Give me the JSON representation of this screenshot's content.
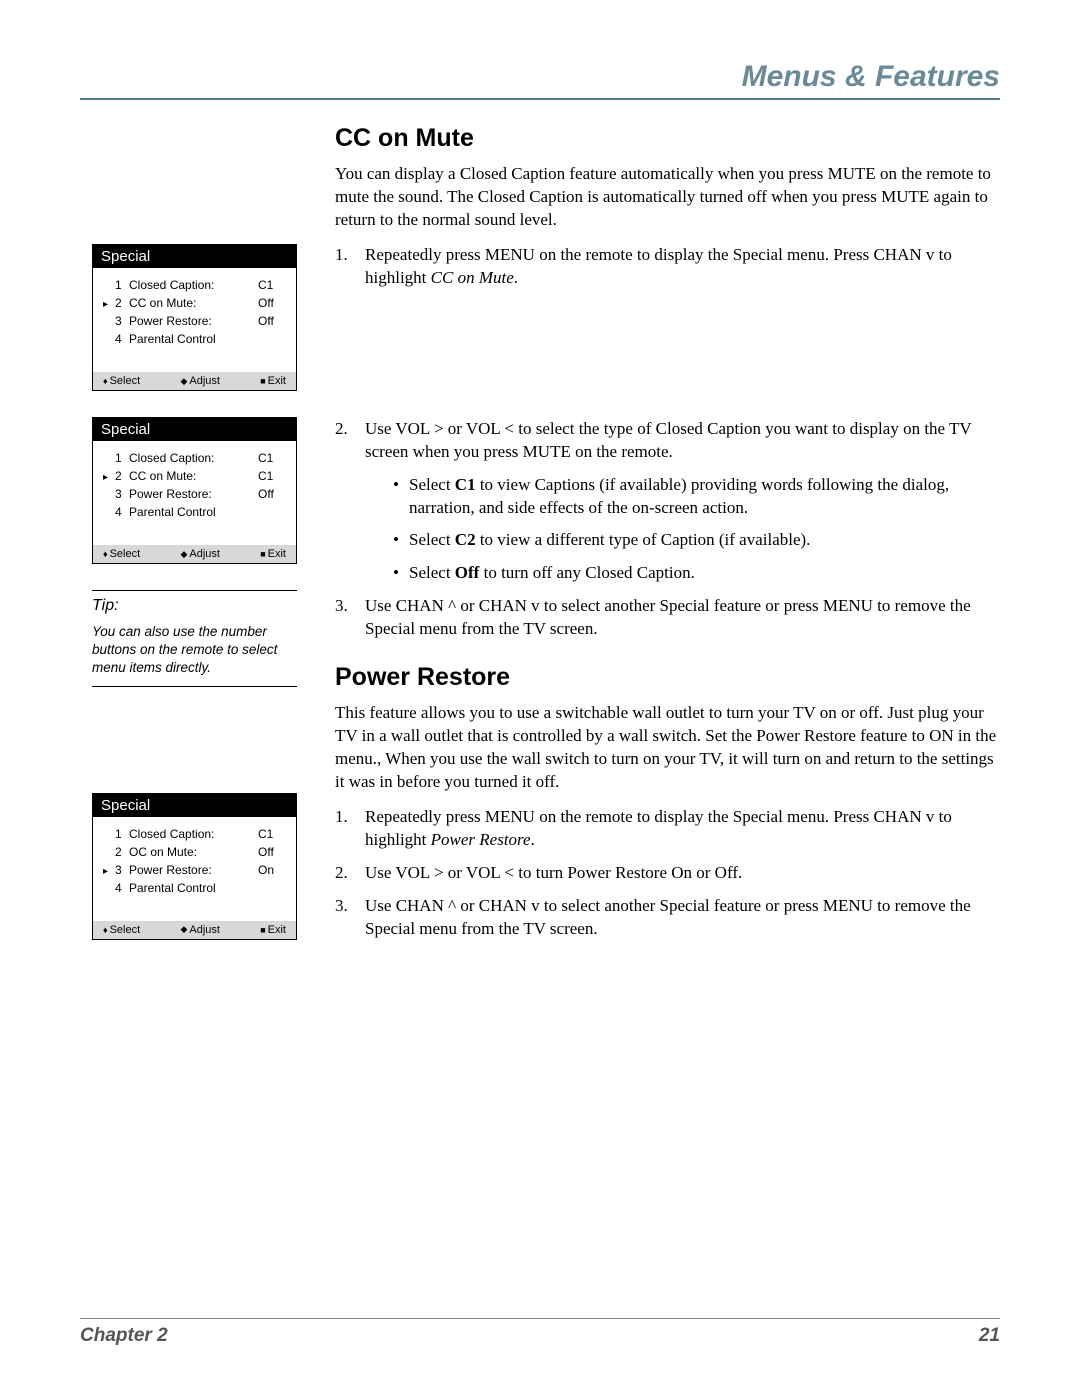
{
  "header": {
    "title": "Menus & Features"
  },
  "section1": {
    "heading": "CC on Mute",
    "intro": "You can display a Closed Caption feature automatically when you press MUTE on the remote to mute the sound. The Closed Caption is automatically turned off when you press MUTE again to return to the normal sound level.",
    "step1_a": "Repeatedly press MENU on the remote to display the Special menu. Press CHAN v to highlight ",
    "step1_b": "CC on Mute",
    "step1_c": ".",
    "step2": "Use VOL > or VOL <  to select the type of Closed Caption you want to display on the TV screen when you press MUTE on the remote.",
    "bullet1_a": "Select ",
    "bullet1_b": "C1",
    "bullet1_c": " to view Captions (if available) providing words following the dialog, narration, and side effects of the on-screen action.",
    "bullet2_a": "Select ",
    "bullet2_b": "C2",
    "bullet2_c": " to view a different type of Caption (if available).",
    "bullet3_a": "Select ",
    "bullet3_b": "Off",
    "bullet3_c": " to turn off any Closed Caption.",
    "step3": "Use CHAN ^ or CHAN v to select another Special feature or press MENU to remove the Special menu from the TV screen."
  },
  "section2": {
    "heading": "Power Restore",
    "intro": "This feature allows you to use a switchable wall outlet to turn your TV on or off.  Just plug your TV in a wall outlet that is controlled by a wall switch. Set the Power Restore feature to ON in the menu., When you use the wall switch to turn on your TV, it will turn on and return to the settings it was in before you turned it off.",
    "step1_a": "Repeatedly press MENU on the remote to display the Special menu. Press CHAN v to highlight ",
    "step1_b": "Power Restore",
    "step1_c": ".",
    "step2": "Use VOL > or VOL <  to turn Power Restore On or Off.",
    "step3": "Use CHAN ^ or CHAN v to select another Special feature or press MENU to remove the Special menu from the TV screen."
  },
  "osd_title": "Special",
  "osd1": {
    "rows": [
      {
        "arrow": "",
        "num": "1",
        "label": "Closed Caption:",
        "val": "C1"
      },
      {
        "arrow": "▸",
        "num": "2",
        "label": "CC on Mute:",
        "val": "Off"
      },
      {
        "arrow": "",
        "num": "3",
        "label": "Power Restore:",
        "val": "Off"
      },
      {
        "arrow": "",
        "num": "4",
        "label": "Parental Control",
        "val": ""
      }
    ]
  },
  "osd2": {
    "rows": [
      {
        "arrow": "",
        "num": "1",
        "label": "Closed Caption:",
        "val": "C1"
      },
      {
        "arrow": "▸",
        "num": "2",
        "label": "CC on Mute:",
        "val": "C1"
      },
      {
        "arrow": "",
        "num": "3",
        "label": "Power Restore:",
        "val": "Off"
      },
      {
        "arrow": "",
        "num": "4",
        "label": "Parental Control",
        "val": ""
      }
    ]
  },
  "osd3": {
    "rows": [
      {
        "arrow": "",
        "num": "1",
        "label": "Closed Caption:",
        "val": "C1"
      },
      {
        "arrow": "",
        "num": "2",
        "label": "OC on Mute:",
        "val": "Off"
      },
      {
        "arrow": "▸",
        "num": "3",
        "label": "Power Restore:",
        "val": "On"
      },
      {
        "arrow": "",
        "num": "4",
        "label": "Parental Control",
        "val": ""
      }
    ]
  },
  "osd_footer": {
    "select": "Select",
    "adjust": "Adjust",
    "exit": "Exit"
  },
  "tip": {
    "label": "Tip:",
    "text": "You can also use the number buttons on the remote to select menu items directly."
  },
  "footer": {
    "chapter": "Chapter 2",
    "page": "21"
  }
}
